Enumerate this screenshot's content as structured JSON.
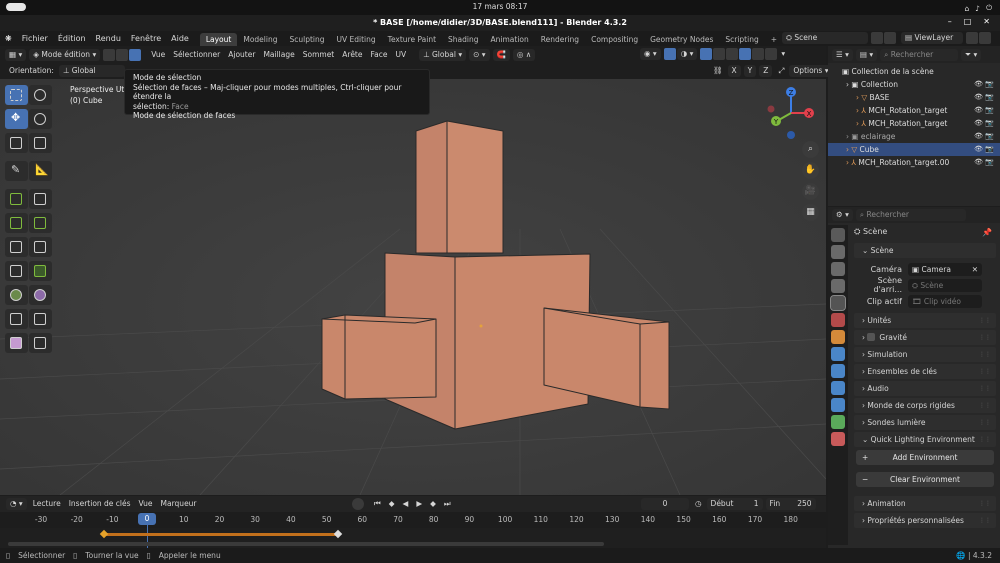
{
  "system": {
    "datetime": "17 mars  08:17"
  },
  "window": {
    "title": "* BASE [/home/didier/3D/BASE.blend111] - Blender 4.3.2"
  },
  "menu": [
    "Fichier",
    "Édition",
    "Rendu",
    "Fenêtre",
    "Aide"
  ],
  "workspaces": [
    "Layout",
    "Modeling",
    "Sculpting",
    "UV Editing",
    "Texture Paint",
    "Shading",
    "Animation",
    "Rendering",
    "Compositing",
    "Geometry Nodes",
    "Scripting"
  ],
  "active_workspace": "Layout",
  "scene_selector": "Scene",
  "viewlayer_selector": "ViewLayer",
  "viewport_header": {
    "mode": "Mode édition",
    "menus": [
      "Vue",
      "Sélectionner",
      "Ajouter",
      "Maillage",
      "Sommet",
      "Arête",
      "Face",
      "UV"
    ],
    "transform": "Global",
    "orientation_label": "Orientation:",
    "orientation_value": "Global",
    "axes": [
      "X",
      "Y",
      "Z"
    ],
    "options": "Options"
  },
  "viewport_info": {
    "line1": "Perspective Uti",
    "line2": "(0) Cube"
  },
  "tooltip": {
    "title": "Mode de sélection",
    "line1": "Sélection de faces – Maj-cliquer pour modes multiples, Ctrl-cliquer pour étendre la",
    "line2_label": "sélection:",
    "line2_value": "Face",
    "line3": "Mode de sélection de faces"
  },
  "nav_gizmo": {
    "x": "X",
    "y": "Y",
    "z": "Z"
  },
  "timeline": {
    "menus": [
      "Lecture",
      "Insertion de clés",
      "Vue",
      "Marqueur"
    ],
    "current_frame": "0",
    "start_label": "Début",
    "start": "1",
    "end_label": "Fin",
    "end": "250",
    "ticks": [
      "-30",
      "-20",
      "-10",
      "0",
      "10",
      "20",
      "30",
      "40",
      "50",
      "60",
      "70",
      "80",
      "90",
      "100",
      "110",
      "120",
      "130",
      "140",
      "150",
      "160",
      "170",
      "180"
    ]
  },
  "status": {
    "select": "Sélectionner",
    "rotate": "Tourner la vue",
    "menu": "Appeler le menu",
    "version": "4.3.2"
  },
  "outliner": {
    "search_placeholder": "Rechercher",
    "root": "Collection de la scène",
    "items": [
      {
        "label": "Collection",
        "indent": 1
      },
      {
        "label": "BASE",
        "indent": 2
      },
      {
        "label": "MCH_Rotation_target",
        "indent": 2
      },
      {
        "label": "MCH_Rotation_target",
        "indent": 2
      },
      {
        "label": "eclairage",
        "indent": 1
      },
      {
        "label": "Cube",
        "indent": 1,
        "selected": true
      },
      {
        "label": "MCH_Rotation_target.00",
        "indent": 1
      }
    ]
  },
  "properties": {
    "search_placeholder": "Rechercher",
    "context": "Scène",
    "section_scene": "Scène",
    "camera_label": "Caméra",
    "camera_value": "Camera",
    "background_label": "Scène d'arri...",
    "background_value": "Scène",
    "clip_label": "Clip actif",
    "clip_value": "Clip vidéo",
    "sections": [
      "Unités",
      "Gravité",
      "Simulation",
      "Ensembles de clés",
      "Audio",
      "Monde de corps rigides",
      "Sondes lumière",
      "Quick Lighting Environment"
    ],
    "add_env": "Add Environment",
    "clear_env": "Clear Environment",
    "sections_after": [
      "Animation",
      "Propriétés personnalisées"
    ]
  },
  "colors": {
    "accent": "#4772b3",
    "cube": "#c9876b",
    "selected_row": "#334d80"
  }
}
